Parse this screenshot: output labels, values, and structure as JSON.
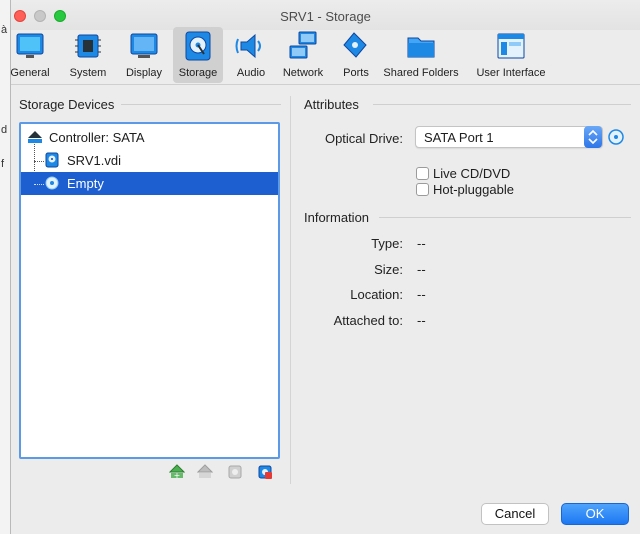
{
  "window": {
    "title": "SRV1 - Storage"
  },
  "background": {
    "chars": [
      "à",
      "d",
      "f"
    ]
  },
  "toolbar": {
    "items": [
      {
        "label": "General",
        "icon": "general-icon"
      },
      {
        "label": "System",
        "icon": "chip-icon"
      },
      {
        "label": "Display",
        "icon": "monitor-icon"
      },
      {
        "label": "Storage",
        "icon": "disk-icon",
        "active": true
      },
      {
        "label": "Audio",
        "icon": "speaker-icon"
      },
      {
        "label": "Network",
        "icon": "network-icon"
      },
      {
        "label": "Ports",
        "icon": "usb-icon"
      },
      {
        "label": "Shared Folders",
        "icon": "folder-icon"
      },
      {
        "label": "User Interface",
        "icon": "window-icon"
      }
    ]
  },
  "storage": {
    "title": "Storage Devices",
    "controller": "Controller: SATA",
    "devices": [
      {
        "label": "SRV1.vdi",
        "icon": "hard-disk-icon"
      },
      {
        "label": "Empty",
        "icon": "optical-disc-icon",
        "selected": true
      }
    ]
  },
  "attributes": {
    "title": "Attributes",
    "optical_drive_label": "Optical Drive:",
    "optical_drive_value": "SATA Port 1",
    "live_cd_label": "Live CD/DVD",
    "live_cd_checked": false,
    "hot_pluggable_label": "Hot-pluggable",
    "hot_pluggable_checked": false
  },
  "information": {
    "title": "Information",
    "rows": [
      {
        "label": "Type:",
        "value": "--"
      },
      {
        "label": "Size:",
        "value": "--"
      },
      {
        "label": "Location:",
        "value": "--"
      },
      {
        "label": "Attached to:",
        "value": "--"
      }
    ]
  },
  "buttons": {
    "cancel": "Cancel",
    "ok": "OK"
  },
  "colors": {
    "accent": "#1d5fd1",
    "ok_button": "#1c78f2",
    "focus_ring": "#5b9ae6"
  }
}
